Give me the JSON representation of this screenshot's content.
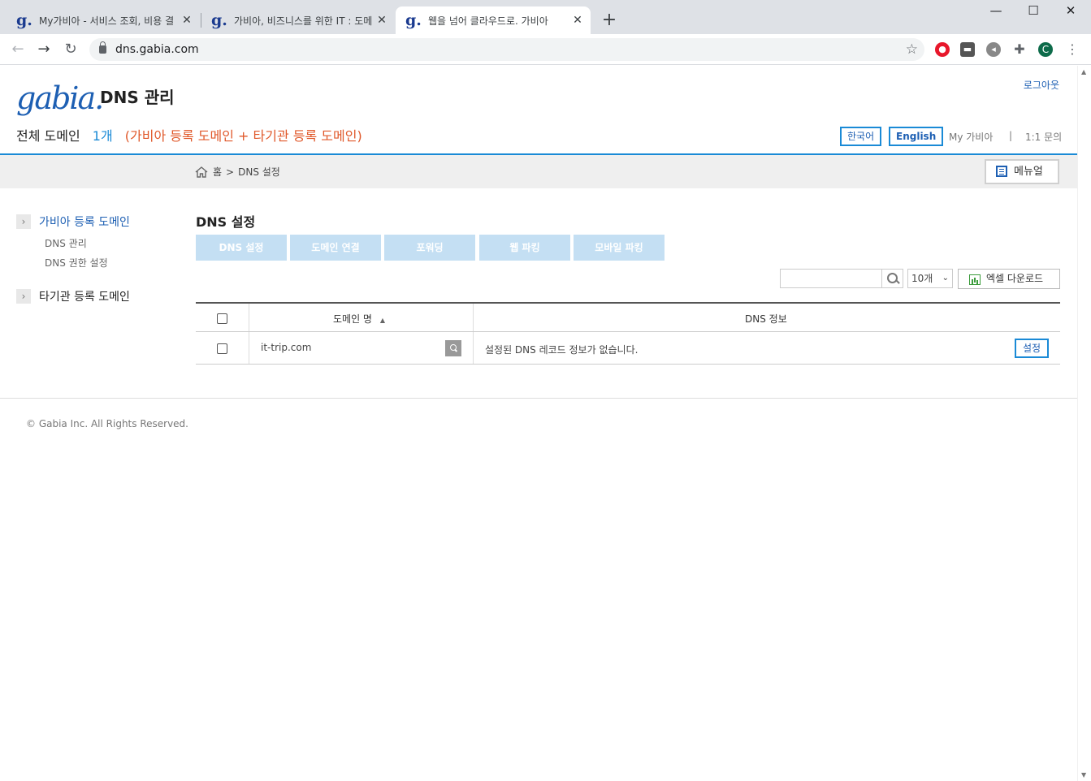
{
  "browser": {
    "tabs": [
      {
        "title": "My가비아 - 서비스 조회, 비용 결",
        "active": false
      },
      {
        "title": "가비아, 비즈니스를 위한 IT : 도메",
        "active": false
      },
      {
        "title": "웹을 넘어 클라우드로. 가비아",
        "active": true
      }
    ],
    "url": "dns.gabia.com",
    "profile_initial": "C"
  },
  "header": {
    "logo": "gabia.",
    "title": "DNS 관리",
    "logout": "로그아웃",
    "all_domain_label": "전체 도메인",
    "domain_count": "1개",
    "domain_note": "(가비아 등록 도메인 + 타기관 등록 도메인)",
    "lang_ko": "한국어",
    "lang_en": "English",
    "my_gabia": "My 가비아",
    "divider": "|",
    "inquiry": "1:1 문의"
  },
  "breadcrumb": {
    "home": "홈",
    "sep": ">",
    "current": "DNS 설정"
  },
  "manual_button": "메뉴얼",
  "sidebar": {
    "group1": "가비아 등록 도메인",
    "group1_items": [
      "DNS 관리",
      "DNS 권한 설정"
    ],
    "group2": "타기관 등록 도메인"
  },
  "main": {
    "title": "DNS 설정",
    "tabs": [
      "DNS 설정",
      "도메인 연결",
      "포워딩",
      "웹 파킹",
      "모바일 파킹"
    ],
    "search_placeholder": "",
    "page_size": "10개",
    "excel_button": "엑셀 다운로드",
    "columns": {
      "domain": "도메인 명",
      "sort_indicator": "▲",
      "dns": "DNS 정보"
    },
    "rows": [
      {
        "domain": "it-trip.com",
        "dns_info": "설정된 DNS 레코드 정보가 없습니다.",
        "action": "설정"
      }
    ]
  },
  "footer": {
    "copyright": "© Gabia Inc. All Rights Reserved."
  },
  "colors": {
    "accent": "#1a8ad6",
    "brand": "#1d5fb3",
    "note": "#e0582a",
    "tab_disabled": "#c4dff3"
  }
}
